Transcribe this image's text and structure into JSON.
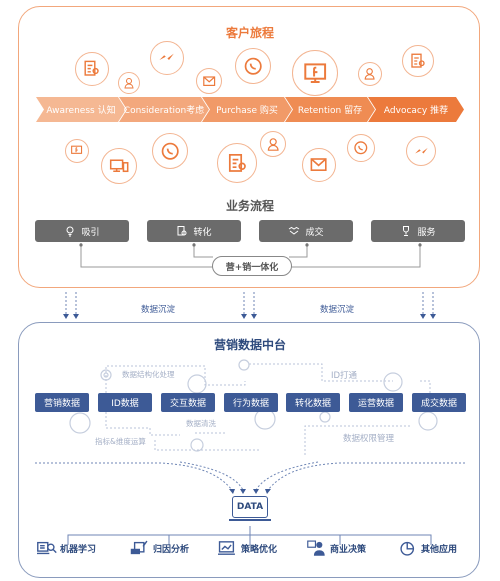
{
  "customer_journey": {
    "title": "客户旅程",
    "stages": [
      {
        "label": "Awareness 认知",
        "color": "#f5b893"
      },
      {
        "label": "Consideration考虑",
        "color": "#f3a87d"
      },
      {
        "label": "Purchase 购买",
        "color": "#f19a68"
      },
      {
        "label": "Retention 留存",
        "color": "#ef8c53"
      },
      {
        "label": "Advocacy 推荐",
        "color": "#ec7a3c"
      }
    ],
    "icons_top": [
      "document-settings-icon",
      "support-agent-icon",
      "messenger-icon",
      "mail-icon",
      "whatsapp-icon",
      "facebook-monitor-icon",
      "support-agent-icon",
      "document-settings-icon"
    ],
    "icons_bottom": [
      "facebook-monitor-icon",
      "devices-icon",
      "whatsapp-icon",
      "document-settings-icon",
      "support-agent-icon",
      "mail-icon",
      "whatsapp-icon",
      "messenger-icon"
    ]
  },
  "business_process": {
    "title": "业务流程",
    "steps": [
      {
        "label": "吸引",
        "icon": "lightbulb-icon"
      },
      {
        "label": "转化",
        "icon": "document-check-icon"
      },
      {
        "label": "成交",
        "icon": "handshake-icon"
      },
      {
        "label": "服务",
        "icon": "trophy-icon"
      }
    ],
    "integration_label": "营+销一体化"
  },
  "sedimentation": {
    "labels": [
      "数据沉淀",
      "数据沉淀"
    ]
  },
  "data_platform": {
    "title": "营销数据中台",
    "data_items": [
      "营销数据",
      "ID数据",
      "交互数据",
      "行为数据",
      "转化数据",
      "运营数据",
      "成交数据"
    ],
    "processes": {
      "structuring": "数据结构化处理",
      "id_linking": "ID打通",
      "cleaning": "数据清洗",
      "metrics": "指标&维度运算",
      "permissions": "数据权限管理"
    },
    "data_label": "DATA",
    "applications": [
      {
        "label": "机器学习",
        "icon": "machine-learning-icon"
      },
      {
        "label": "归因分析",
        "icon": "attribution-icon"
      },
      {
        "label": "策略优化",
        "icon": "strategy-chart-icon"
      },
      {
        "label": "商业决策",
        "icon": "business-decision-icon"
      },
      {
        "label": "其他应用",
        "icon": "pie-chart-icon"
      }
    ]
  },
  "colors": {
    "orange": "#ec7a3c",
    "navy": "#3d5a96",
    "gray": "#6b6b6b"
  }
}
